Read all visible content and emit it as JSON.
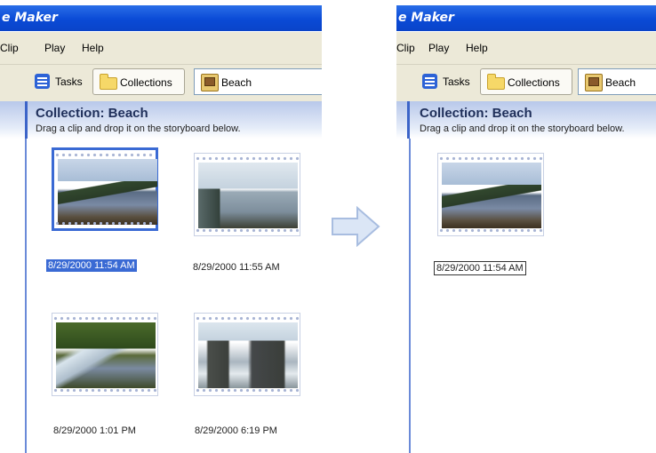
{
  "window": {
    "title": "e Maker"
  },
  "menu": {
    "items": [
      "Clip",
      "Play",
      "Help"
    ]
  },
  "toolbar": {
    "tasks_label": "Tasks",
    "collections_label": "Collections",
    "beach_label": "Beach"
  },
  "collection": {
    "title": "Collection: Beach",
    "instructions": "Drag a clip and drop it on the storyboard below."
  },
  "clips": [
    {
      "caption": "8/29/2000 11:54 AM",
      "thumbnail": "lake-mountain-thumbnail",
      "selected": true
    },
    {
      "caption": "8/29/2000 11:55 AM",
      "thumbnail": "lake-shore-thumbnail"
    },
    {
      "caption": "8/29/2000 1:01 PM",
      "thumbnail": "stream-thumbnail"
    },
    {
      "caption": "8/29/2000 6:19 PM",
      "thumbnail": "sea-stacks-thumbnail"
    }
  ],
  "renaming_clip": {
    "caption": "8/29/2000 11:54 AM",
    "state": "editing"
  },
  "arrow_icon": "right-arrow-icon",
  "colors": {
    "title_bar": "#0a4ad6",
    "selection": "#3a6ad4",
    "header_gradient": "#b8c8ea",
    "menu_bg": "#ece9d8"
  }
}
